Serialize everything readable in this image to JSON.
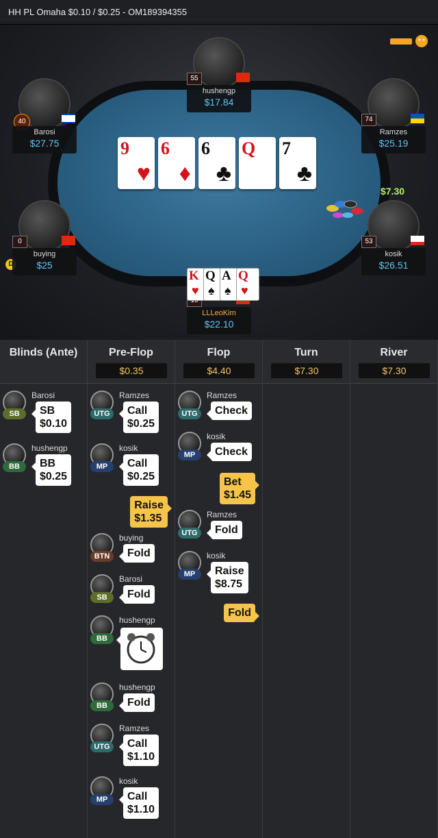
{
  "header": {
    "title": "HH PL Omaha $0.10 / $0.25   - OM189394355"
  },
  "colors": {
    "stack": "#5dc8f3",
    "pot": "#f5c26b",
    "hero_action": "#f7c44a",
    "utg": "#2d6a6a",
    "mp": "#25406e",
    "bb": "#2e6b3b",
    "sb": "#5b6e2a",
    "btn": "#6b3b2a"
  },
  "table": {
    "board": [
      {
        "rank": "9",
        "suit": "♥",
        "color": "red"
      },
      {
        "rank": "6",
        "suit": "♦",
        "color": "red"
      },
      {
        "rank": "6",
        "suit": "♣",
        "color": "black"
      },
      {
        "rank": "Q",
        "suit": "",
        "color": "red"
      },
      {
        "rank": "7",
        "suit": "♣",
        "color": "black"
      }
    ],
    "bet_display": "$7.30",
    "dealer_button": "D",
    "seats": [
      {
        "name": "hushengp",
        "stack": "$17.84",
        "level": "55"
      },
      {
        "name": "Barosi",
        "stack": "$27.75",
        "level": "40"
      },
      {
        "name": "Ramzes",
        "stack": "$25.19",
        "level": "74"
      },
      {
        "name": "buying",
        "stack": "$25",
        "level": "0"
      },
      {
        "name": "kosik",
        "stack": "$26.51",
        "level": "53"
      },
      {
        "name": "LLLeoKim",
        "stack": "$22.10",
        "level": "16"
      }
    ],
    "hero_cards": [
      {
        "rank": "K",
        "suit": "♥",
        "color": "red"
      },
      {
        "rank": "Q",
        "suit": "♠",
        "color": "black"
      },
      {
        "rank": "A",
        "suit": "♠",
        "color": "black"
      },
      {
        "rank": "Q",
        "suit": "♥",
        "color": "red"
      }
    ]
  },
  "columns": [
    {
      "title": "Blinds (Ante)",
      "pot": ""
    },
    {
      "title": "Pre-Flop",
      "pot": "$0.35"
    },
    {
      "title": "Flop",
      "pot": "$4.40"
    },
    {
      "title": "Turn",
      "pot": "$7.30"
    },
    {
      "title": "River",
      "pot": "$7.30"
    }
  ],
  "blinds": [
    {
      "name": "Barosi",
      "pos": "SB",
      "line1": "SB",
      "line2": "$0.10"
    },
    {
      "name": "hushengp",
      "pos": "BB",
      "line1": "BB",
      "line2": "$0.25"
    }
  ],
  "preflop": [
    {
      "name": "Ramzes",
      "pos": "UTG",
      "line1": "Call",
      "line2": "$0.25"
    },
    {
      "name": "kosik",
      "pos": "MP",
      "line1": "Call",
      "line2": "$0.25"
    },
    {
      "hero": true,
      "line1": "Raise",
      "line2": "$1.35"
    },
    {
      "name": "buying",
      "pos": "BTN",
      "line1": "Fold"
    },
    {
      "name": "Barosi",
      "pos": "SB",
      "line1": "Fold"
    },
    {
      "name": "hushengp",
      "pos": "BB",
      "line1": "",
      "clock": true
    },
    {
      "name": "hushengp",
      "pos": "BB",
      "line1": "Fold"
    },
    {
      "name": "Ramzes",
      "pos": "UTG",
      "line1": "Call",
      "line2": "$1.10"
    },
    {
      "name": "kosik",
      "pos": "MP",
      "line1": "Call",
      "line2": "$1.10"
    }
  ],
  "flop": [
    {
      "name": "Ramzes",
      "pos": "UTG",
      "line1": "Check"
    },
    {
      "name": "kosik",
      "pos": "MP",
      "line1": "Check"
    },
    {
      "hero": true,
      "line1": "Bet",
      "line2": "$1.45"
    },
    {
      "name": "Ramzes",
      "pos": "UTG",
      "line1": "Fold"
    },
    {
      "name": "kosik",
      "pos": "MP",
      "line1": "Raise",
      "line2": "$8.75"
    },
    {
      "hero": true,
      "line1": "Fold"
    }
  ]
}
